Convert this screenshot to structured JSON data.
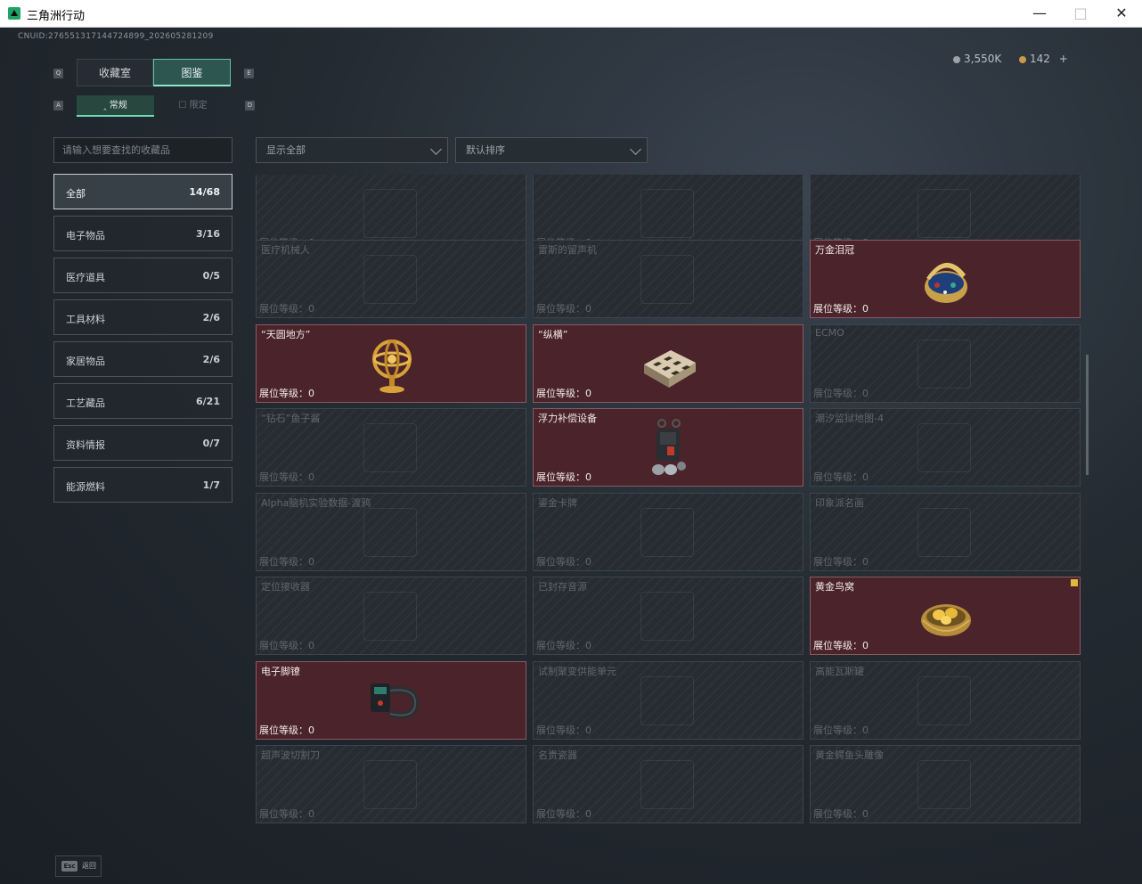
{
  "window": {
    "title": "三角洲行动"
  },
  "header": {
    "uid": "CNUID:276551317144724899_202605281209",
    "currency1": "3,550K",
    "currency2": "142",
    "currency2_add": "+"
  },
  "tabs": [
    {
      "label": "收藏室",
      "active": false
    },
    {
      "label": "图鉴",
      "active": true
    }
  ],
  "subtabs": [
    {
      "label": "常规",
      "active": true
    },
    {
      "label": "限定",
      "active": false
    }
  ],
  "search": {
    "placeholder": "请输入想要查找的收藏品"
  },
  "filters": {
    "show": "显示全部",
    "sort": "默认排序"
  },
  "categories": [
    {
      "name": "全部",
      "count": "14/68",
      "active": true
    },
    {
      "name": "电子物品",
      "count": "3/16"
    },
    {
      "name": "医疗道具",
      "count": "0/5"
    },
    {
      "name": "工具材料",
      "count": "2/6"
    },
    {
      "name": "家居物品",
      "count": "2/6"
    },
    {
      "name": "工艺藏品",
      "count": "6/21"
    },
    {
      "name": "资料情报",
      "count": "0/7"
    },
    {
      "name": "能源燃料",
      "count": "1/7"
    }
  ],
  "level_label": "展位等级：",
  "cards": [
    {
      "name": "",
      "level": "0",
      "owned": false
    },
    {
      "name": "",
      "level": "0",
      "owned": false
    },
    {
      "name": "",
      "level": "0",
      "owned": false
    },
    {
      "name": "医疗机械人",
      "level": "0",
      "owned": false
    },
    {
      "name": "雷斯的留声机",
      "level": "0",
      "owned": false
    },
    {
      "name": "万金泪冠",
      "level": "0",
      "owned": true,
      "icon": "jeweled-egg-icon"
    },
    {
      "name": "“天圆地方”",
      "level": "0",
      "owned": true,
      "icon": "armillary-sphere-icon"
    },
    {
      "name": "“纵横”",
      "level": "0",
      "owned": true,
      "icon": "chess-box-icon"
    },
    {
      "name": "ECMO",
      "level": "0",
      "owned": false
    },
    {
      "name": "“钻石”鱼子酱",
      "level": "0",
      "owned": false
    },
    {
      "name": "浮力补偿设备",
      "level": "0",
      "owned": true,
      "icon": "buoyancy-device-icon"
    },
    {
      "name": "潮汐监狱地图-4",
      "level": "0",
      "owned": false
    },
    {
      "name": "Alpha脑机实验数据-渡鸦",
      "level": "0",
      "owned": false
    },
    {
      "name": "鎏金卡牌",
      "level": "0",
      "owned": false
    },
    {
      "name": "印象派名画",
      "level": "0",
      "owned": false
    },
    {
      "name": "定位接收器",
      "level": "0",
      "owned": false
    },
    {
      "name": "已封存音源",
      "level": "0",
      "owned": false
    },
    {
      "name": "黄金鸟窝",
      "level": "0",
      "owned": true,
      "icon": "golden-nest-icon",
      "badge": true
    },
    {
      "name": "电子脚镣",
      "level": "0",
      "owned": true,
      "icon": "electronic-anklet-icon"
    },
    {
      "name": "试制聚变供能单元",
      "level": "0",
      "owned": false
    },
    {
      "name": "高能瓦斯罐",
      "level": "0",
      "owned": false
    },
    {
      "name": "超声波切割刀",
      "level": "0",
      "owned": false
    },
    {
      "name": "名贵瓷器",
      "level": "0",
      "owned": false
    },
    {
      "name": "黄金鳄鱼头雕像",
      "level": "0",
      "owned": false
    }
  ],
  "footer": {
    "esc_key": "Esc",
    "esc_label": "返回"
  },
  "colors": {
    "owned_card": "#4a242a",
    "accent": "#5ec6a6",
    "card_bg": "#262c32"
  }
}
